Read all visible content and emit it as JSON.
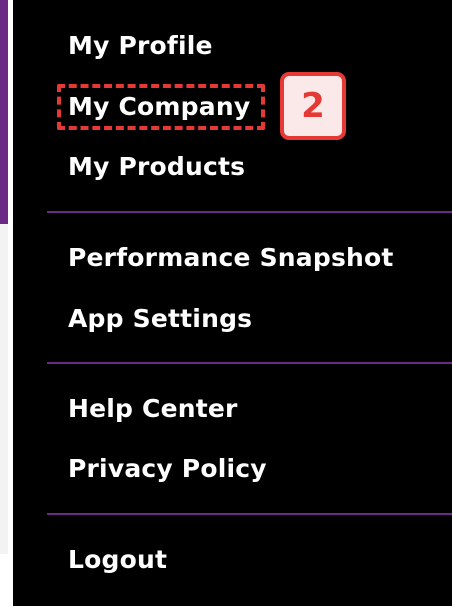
{
  "menu": {
    "sections": [
      {
        "items": [
          {
            "label": "My Profile"
          },
          {
            "label": "My Company"
          },
          {
            "label": "My Products"
          }
        ]
      },
      {
        "items": [
          {
            "label": "Performance Snapshot"
          },
          {
            "label": "App Settings"
          }
        ]
      },
      {
        "items": [
          {
            "label": "Help Center"
          },
          {
            "label": "Privacy Policy"
          }
        ]
      },
      {
        "items": [
          {
            "label": "Logout"
          }
        ]
      }
    ]
  },
  "annotation": {
    "step_number": "2"
  },
  "colors": {
    "menu_background": "#000000",
    "divider": "#6a2a86",
    "highlight": "#e53935",
    "badge_background": "#fbe9e9",
    "text": "#ffffff"
  }
}
